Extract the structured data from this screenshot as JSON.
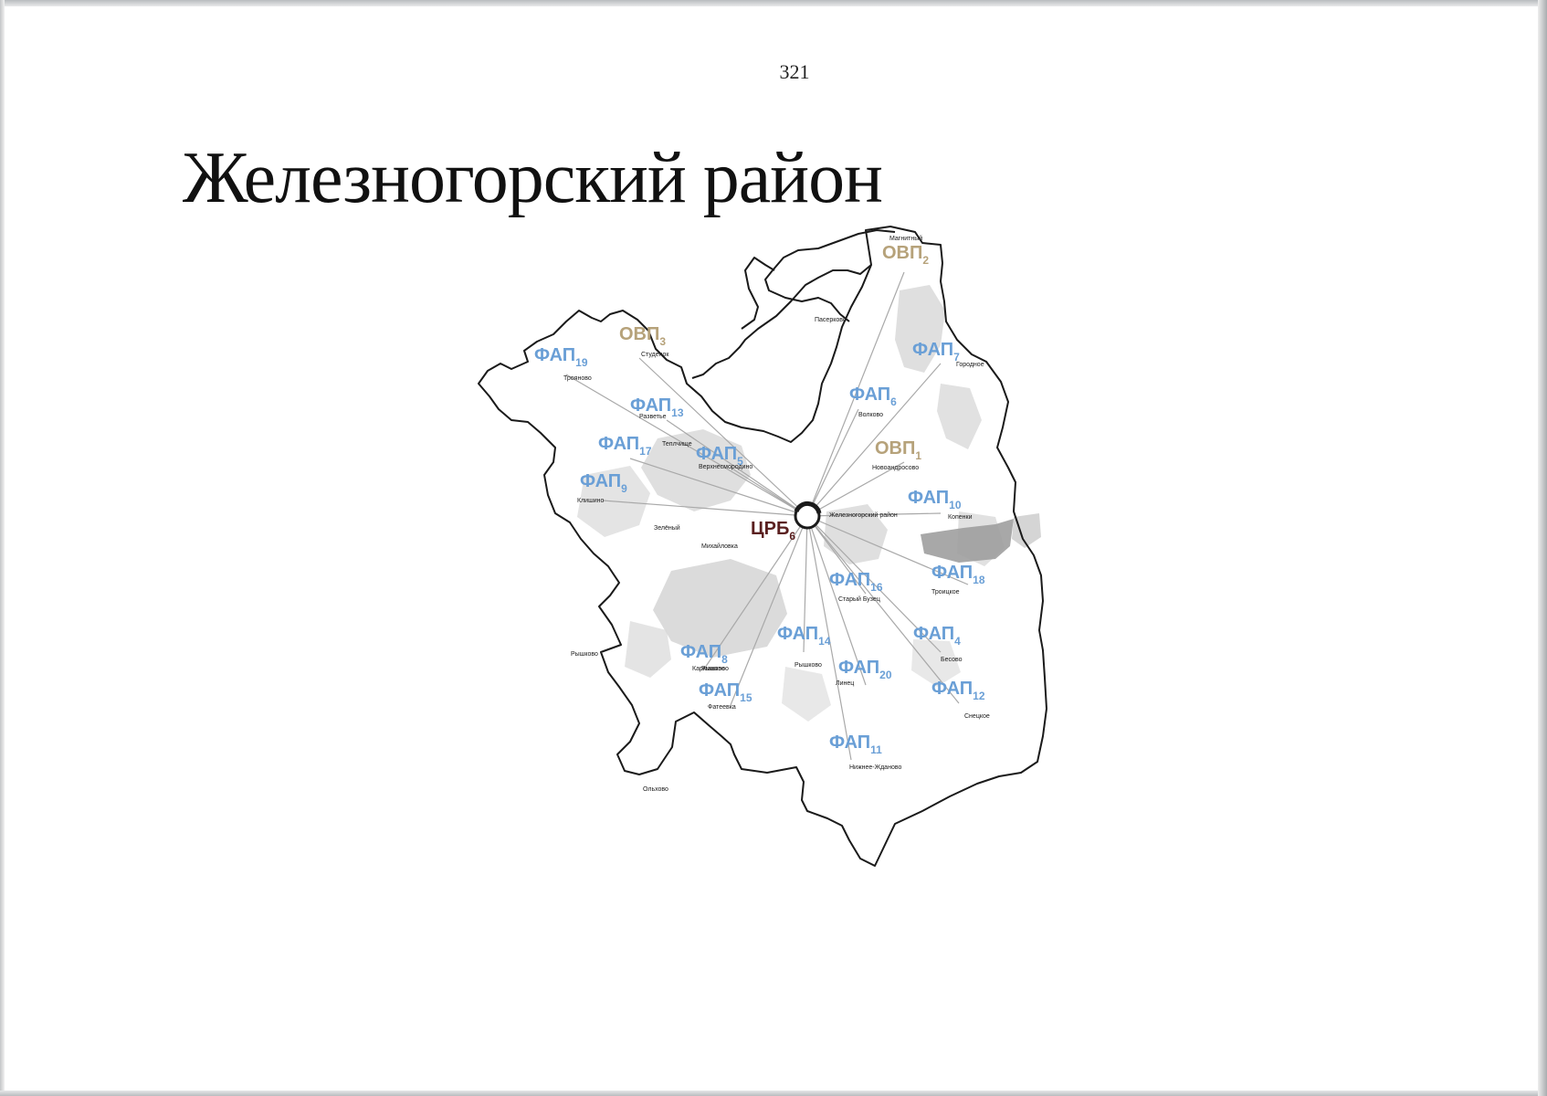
{
  "page": {
    "number": "321",
    "title": "Железногорский район"
  },
  "map": {
    "colors": {
      "fap": "#6a9fd6",
      "ovp": "#b6a27a",
      "crb": "#5a1f1f",
      "border": "#1a1a1a",
      "connector": "#a9a9a9",
      "forest": "#d2d2d2",
      "forest_dark": "#9a9a9a"
    },
    "hub": {
      "label": "ЦРБ",
      "sub": "6"
    },
    "facilities": [
      {
        "id": "ovp2",
        "label": "ОВП",
        "sub": "2",
        "kind": "ovp"
      },
      {
        "id": "ovp3",
        "label": "ОВП",
        "sub": "3",
        "kind": "ovp"
      },
      {
        "id": "fap19",
        "label": "ФАП",
        "sub": "19",
        "kind": "fap"
      },
      {
        "id": "fap7",
        "label": "ФАП",
        "sub": "7",
        "kind": "fap"
      },
      {
        "id": "fap13",
        "label": "ФАП",
        "sub": "13",
        "kind": "fap"
      },
      {
        "id": "fap6",
        "label": "ФАП",
        "sub": "6",
        "kind": "fap"
      },
      {
        "id": "fap17",
        "label": "ФАП",
        "sub": "17",
        "kind": "fap"
      },
      {
        "id": "fap5",
        "label": "ФАП",
        "sub": "5",
        "kind": "fap"
      },
      {
        "id": "ovp1",
        "label": "ОВП",
        "sub": "1",
        "kind": "ovp"
      },
      {
        "id": "fap9",
        "label": "ФАП",
        "sub": "9",
        "kind": "fap"
      },
      {
        "id": "fap10",
        "label": "ФАП",
        "sub": "10",
        "kind": "fap"
      },
      {
        "id": "fap18",
        "label": "ФАП",
        "sub": "18",
        "kind": "fap"
      },
      {
        "id": "fap16",
        "label": "ФАП",
        "sub": "16",
        "kind": "fap"
      },
      {
        "id": "fap14",
        "label": "ФАП",
        "sub": "14",
        "kind": "fap"
      },
      {
        "id": "fap4",
        "label": "ФАП",
        "sub": "4",
        "kind": "fap"
      },
      {
        "id": "fap8",
        "label": "ФАП",
        "sub": "8",
        "kind": "fap"
      },
      {
        "id": "fap20",
        "label": "ФАП",
        "sub": "20",
        "kind": "fap"
      },
      {
        "id": "fap15",
        "label": "ФАП",
        "sub": "15",
        "kind": "fap"
      },
      {
        "id": "fap12",
        "label": "ФАП",
        "sub": "12",
        "kind": "fap"
      },
      {
        "id": "fap11",
        "label": "ФАП",
        "sub": "11",
        "kind": "fap"
      }
    ],
    "settlements": [
      "Магнитный",
      "Пасерково",
      "Студенок",
      "Трояново",
      "Городное",
      "Разветье",
      "Волково",
      "Теплчище",
      "Верхнесмородино",
      "Новоандросово",
      "Клишино",
      "Железногорский район",
      "Копенки",
      "Зелёный",
      "Михайловка",
      "Троицкое",
      "Старый Бузец",
      "Рышково",
      "Бесово",
      "Рышково",
      "Карманово",
      "Фатеевка",
      "Снецкое",
      "Нижнее-Жданово",
      "Линец",
      "Рышково",
      "Ольхово"
    ]
  }
}
